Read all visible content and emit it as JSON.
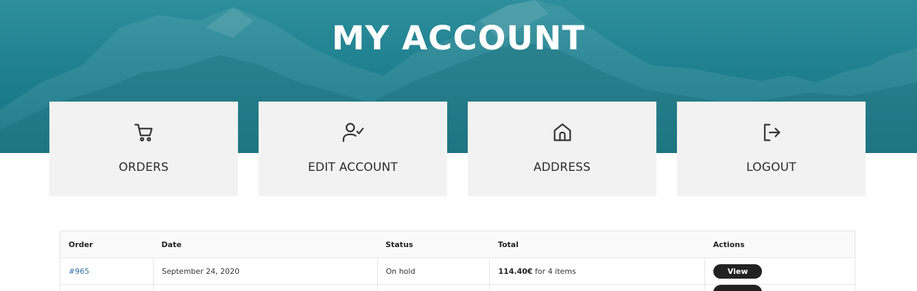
{
  "header": {
    "title": "MY ACCOUNT"
  },
  "tiles": [
    {
      "label": "ORDERS",
      "icon": "cart-icon"
    },
    {
      "label": "EDIT ACCOUNT",
      "icon": "user-check-icon"
    },
    {
      "label": "ADDRESS",
      "icon": "home-icon"
    },
    {
      "label": "LOGOUT",
      "icon": "logout-icon"
    }
  ],
  "orders_table": {
    "columns": [
      "Order",
      "Date",
      "Status",
      "Total",
      "Actions"
    ],
    "rows": [
      {
        "order": "#965",
        "date": "September 24, 2020",
        "status": "On hold",
        "total_amount": "114.40€",
        "total_items": " for 4 items",
        "action": "View"
      }
    ]
  },
  "colors": {
    "hero": "#1c7d8c",
    "tile_bg": "#f2f2f2",
    "link": "#2f6fa5",
    "button": "#222222"
  }
}
